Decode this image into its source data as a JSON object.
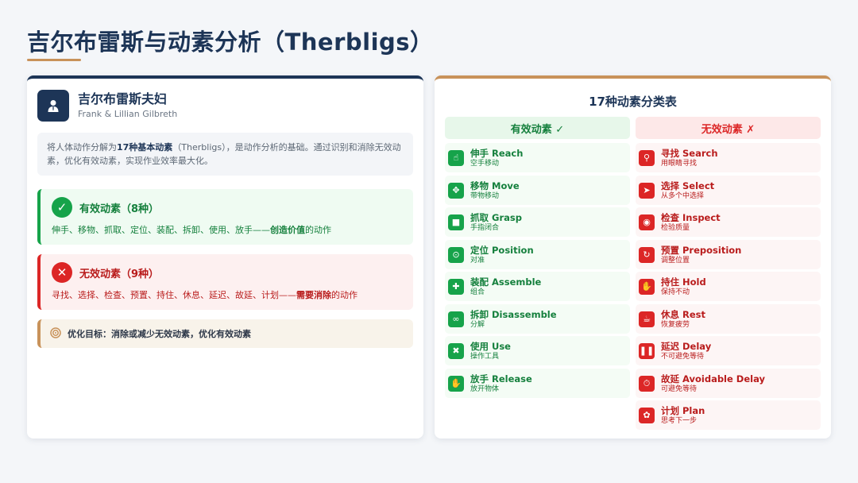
{
  "title": "吉尔布雷斯与动素分析（Therbligs）",
  "profile": {
    "name": "吉尔布雷斯夫妇",
    "subtitle": "Frank & Lillian Gilbreth"
  },
  "intro": {
    "before": "将人体动作分解为",
    "bold": "17种基本动素",
    "after": "（Therbligs），是动作分析的基础。通过识别和消除无效动素，优化有效动素，实现作业效率最大化。"
  },
  "effective": {
    "title": "有效动素（8种）",
    "desc_before": "伸手、移物、抓取、定位、装配、拆卸、使用、放手——",
    "desc_bold": "创造价值",
    "desc_after": "的动作"
  },
  "ineffective": {
    "title": "无效动素（9种）",
    "desc_before": "寻找、选择、检查、预置、持住、休息、延迟、故延、计划——",
    "desc_bold": "需要消除",
    "desc_after": "的动作"
  },
  "goal": {
    "text": "优化目标：消除或减少无效动素，优化有效动素"
  },
  "table": {
    "title": "17种动素分类表",
    "effective_header": "有效动素 ✓",
    "ineffective_header": "无效动素 ✗",
    "effective_items": [
      {
        "name": "伸手 Reach",
        "desc": "空手移动",
        "icon": "hand-pointer-icon"
      },
      {
        "name": "移物 Move",
        "desc": "带物移动",
        "icon": "arrows-move-icon"
      },
      {
        "name": "抓取 Grasp",
        "desc": "手指闭合",
        "icon": "fist-icon"
      },
      {
        "name": "定位 Position",
        "desc": "对准",
        "icon": "crosshair-icon"
      },
      {
        "name": "装配 Assemble",
        "desc": "组合",
        "icon": "puzzle-icon"
      },
      {
        "name": "拆卸 Disassemble",
        "desc": "分解",
        "icon": "unlink-icon"
      },
      {
        "name": "使用 Use",
        "desc": "操作工具",
        "icon": "tools-icon"
      },
      {
        "name": "放手 Release",
        "desc": "放开物体",
        "icon": "open-hand-icon"
      }
    ],
    "ineffective_items": [
      {
        "name": "寻找 Search",
        "desc": "用眼睛寻找",
        "icon": "search-icon"
      },
      {
        "name": "选择 Select",
        "desc": "从多个中选择",
        "icon": "cursor-icon"
      },
      {
        "name": "检查 Inspect",
        "desc": "检验质量",
        "icon": "eye-icon"
      },
      {
        "name": "预置 Preposition",
        "desc": "调整位置",
        "icon": "rotate-icon"
      },
      {
        "name": "持住 Hold",
        "desc": "保持不动",
        "icon": "hand-stop-icon"
      },
      {
        "name": "休息 Rest",
        "desc": "恢复疲劳",
        "icon": "coffee-icon"
      },
      {
        "name": "延迟 Delay",
        "desc": "不可避免等待",
        "icon": "pause-icon"
      },
      {
        "name": "故延 Avoidable Delay",
        "desc": "可避免等待",
        "icon": "stopwatch-icon"
      },
      {
        "name": "计划 Plan",
        "desc": "思考下一步",
        "icon": "brain-icon"
      }
    ]
  },
  "colors": {
    "navy": "#1d3557",
    "accent": "#c8925a",
    "green": "#16a34a",
    "red": "#dc2626"
  }
}
